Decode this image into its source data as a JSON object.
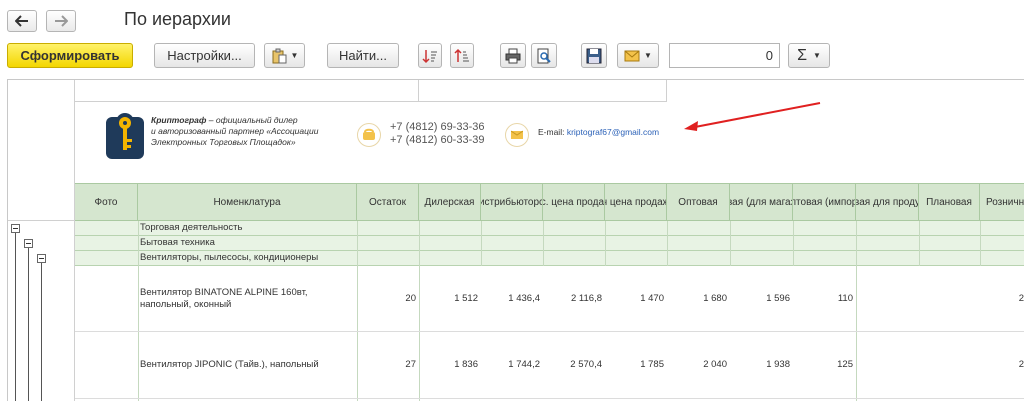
{
  "window": {
    "title": "По иерархии"
  },
  "nav": {
    "back_icon": "arrow-left-icon",
    "forward_icon": "arrow-right-icon"
  },
  "toolbar": {
    "generate_label": "Сформировать",
    "settings_label": "Настройки...",
    "find_label": "Найти...",
    "sum_value": "0",
    "sigma_label": "Σ"
  },
  "company": {
    "name": "Криптограф",
    "desc_line1": " – официальный дилер",
    "desc_line2": "и авторизованный партнер «Ассоциации",
    "desc_line3": "Электронных Торговых Площадок»",
    "phone1": "+7 (4812) 69-33-36",
    "phone2": "+7 (4812) 60-33-39",
    "email_label": "E-mail:",
    "email": "kriptograf67@gmail.com"
  },
  "columns": [
    "Фото",
    "Номенклатура",
    "Остаток",
    "Дилерская",
    "истрибьюторс",
    "кс. цена продаж",
    "н цена продаж",
    "Оптовая",
    "вая (для магаз",
    "птовая (импор",
    "вая для проду",
    "Плановая",
    "Розничн"
  ],
  "groups": [
    "Торговая деятельность",
    "Бытовая техника",
    "Вентиляторы, пылесосы, кондиционеры"
  ],
  "rows": [
    {
      "name_line1": "Вентилятор BINATONE ALPINE 160вт,",
      "name_line2": "напольный, оконный",
      "values": [
        "20",
        "1 512",
        "1 436,4",
        "2 116,8",
        "1 470",
        "1 680",
        "1 596",
        "110",
        "2"
      ]
    },
    {
      "name_line1": "Вентилятор JIPONIC (Тайв.), напольный",
      "name_line2": "",
      "values": [
        "27",
        "1 836",
        "1 744,2",
        "2 570,4",
        "1 785",
        "2 040",
        "1 938",
        "125",
        "2"
      ]
    }
  ],
  "colors": {
    "accent": "#f3d600",
    "header_bg": "#d5e6cf",
    "group_bg": "#e8f3e4",
    "arrow": "#e02020",
    "logo_blue": "#1f3a5a",
    "logo_key": "#f4b400"
  }
}
